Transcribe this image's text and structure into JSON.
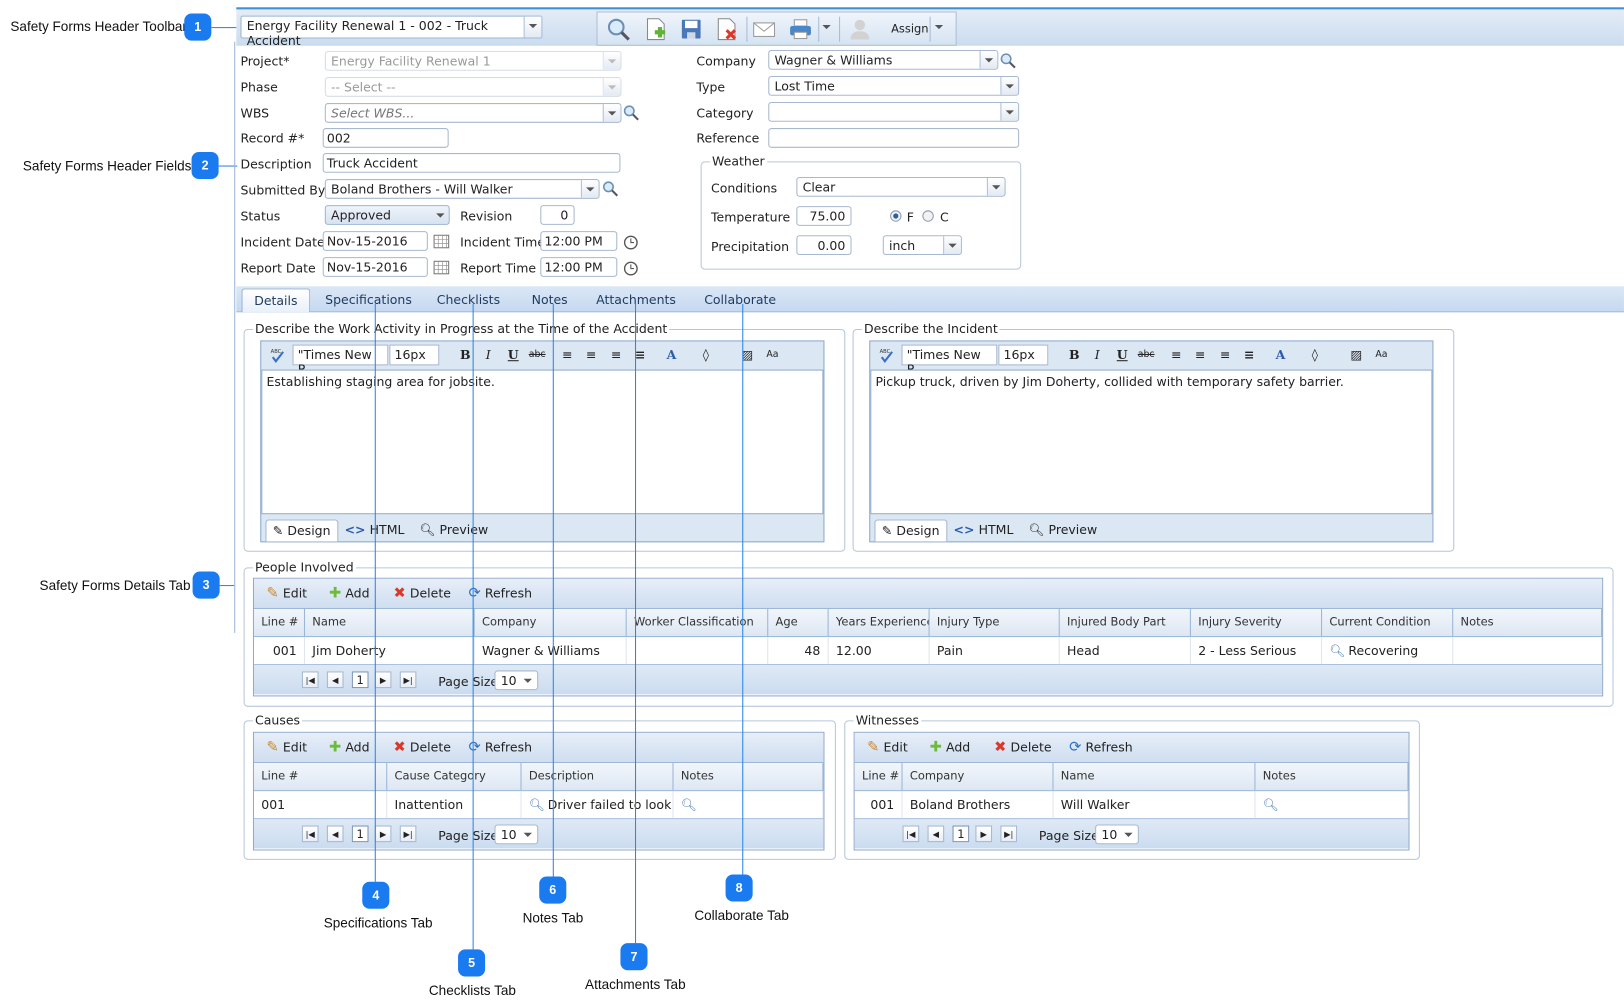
{
  "callouts": [
    {
      "n": "1",
      "label": "Safety Forms Header Toolbar"
    },
    {
      "n": "2",
      "label": "Safety Forms Header Fields"
    },
    {
      "n": "3",
      "label": "Safety Forms Details Tab"
    },
    {
      "n": "4",
      "label": "Specifications Tab"
    },
    {
      "n": "5",
      "label": "Checklists Tab"
    },
    {
      "n": "6",
      "label": "Notes Tab"
    },
    {
      "n": "7",
      "label": "Attachments Tab"
    },
    {
      "n": "8",
      "label": "Collaborate Tab"
    }
  ],
  "toolbar": {
    "record_selector": "Energy Facility Renewal 1 - 002 - Truck Accident",
    "icons": [
      "search-icon",
      "new-document-icon",
      "save-icon",
      "delete-document-icon",
      "email-icon",
      "print-icon",
      "user-icon"
    ],
    "assign_label": "Assign"
  },
  "header_fields": {
    "project": {
      "label": "Project*",
      "value": "Energy Facility Renewal 1"
    },
    "phase": {
      "label": "Phase",
      "value": "-- Select --"
    },
    "wbs": {
      "label": "WBS",
      "placeholder": "Select WBS..."
    },
    "record": {
      "label": "Record #*",
      "value": "002"
    },
    "description": {
      "label": "Description",
      "value": "Truck Accident"
    },
    "submitted_by": {
      "label": "Submitted By",
      "value": "Boland Brothers - Will Walker"
    },
    "status": {
      "label": "Status",
      "value": "Approved"
    },
    "revision": {
      "label": "Revision",
      "value": "0"
    },
    "incident_date": {
      "label": "Incident Date",
      "value": "Nov-15-2016"
    },
    "incident_time": {
      "label": "Incident Time",
      "value": "12:00 PM"
    },
    "report_date": {
      "label": "Report Date",
      "value": "Nov-15-2016"
    },
    "report_time": {
      "label": "Report Time",
      "value": "12:00 PM"
    },
    "company": {
      "label": "Company",
      "value": "Wagner & Williams"
    },
    "type": {
      "label": "Type",
      "value": "Lost Time"
    },
    "category": {
      "label": "Category",
      "value": ""
    },
    "reference": {
      "label": "Reference",
      "value": ""
    },
    "weather": {
      "title": "Weather",
      "conditions": {
        "label": "Conditions",
        "value": "Clear"
      },
      "temperature": {
        "label": "Temperature",
        "value": "75.00",
        "unit_f": "F",
        "unit_c": "C",
        "selected": "F"
      },
      "precipitation": {
        "label": "Precipitation",
        "value": "0.00",
        "unit": "inch"
      }
    }
  },
  "tabs": [
    {
      "label": "Details",
      "active": true
    },
    {
      "label": "Specifications"
    },
    {
      "label": "Checklists"
    },
    {
      "label": "Notes"
    },
    {
      "label": "Attachments"
    },
    {
      "label": "Collaborate"
    }
  ],
  "editors": [
    {
      "title": "Describe the Work Activity in Progress at the Time of the Accident",
      "font": "\"Times New R...",
      "size": "16px",
      "content": "Establishing staging area for jobsite.",
      "modes": [
        "Design",
        "HTML",
        "Preview"
      ]
    },
    {
      "title": "Describe the Incident",
      "font": "\"Times New R...",
      "size": "16px",
      "content": "Pickup truck, driven by Jim Doherty, collided with temporary safety barrier.",
      "modes": [
        "Design",
        "HTML",
        "Preview"
      ]
    }
  ],
  "grid_commands": {
    "edit": "Edit",
    "add": "Add",
    "delete": "Delete",
    "refresh": "Refresh"
  },
  "pager": {
    "page": "1",
    "page_size_label": "Page Size",
    "page_size": "10"
  },
  "people_involved": {
    "title": "People Involved",
    "columns": [
      "Line #",
      "Name",
      "Company",
      "Worker Classification",
      "Age",
      "Years Experience",
      "Injury Type",
      "Injured Body Part",
      "Injury Severity",
      "Current Condition",
      "Notes"
    ],
    "rows": [
      [
        "001",
        "Jim Doherty",
        "Wagner & Williams",
        "",
        "48",
        "12.00",
        "Pain",
        "Head",
        "2 - Less Serious",
        "Recovering",
        ""
      ]
    ]
  },
  "causes": {
    "title": "Causes",
    "columns": [
      "Line #",
      "Cause Category",
      "Description",
      "Notes"
    ],
    "rows": [
      [
        "001",
        "Inattention",
        "Driver failed to look bel",
        ""
      ]
    ]
  },
  "witnesses": {
    "title": "Witnesses",
    "columns": [
      "Line #",
      "Company",
      "Name",
      "Notes"
    ],
    "rows": [
      [
        "001",
        "Boland Brothers",
        "Will Walker",
        ""
      ]
    ]
  }
}
